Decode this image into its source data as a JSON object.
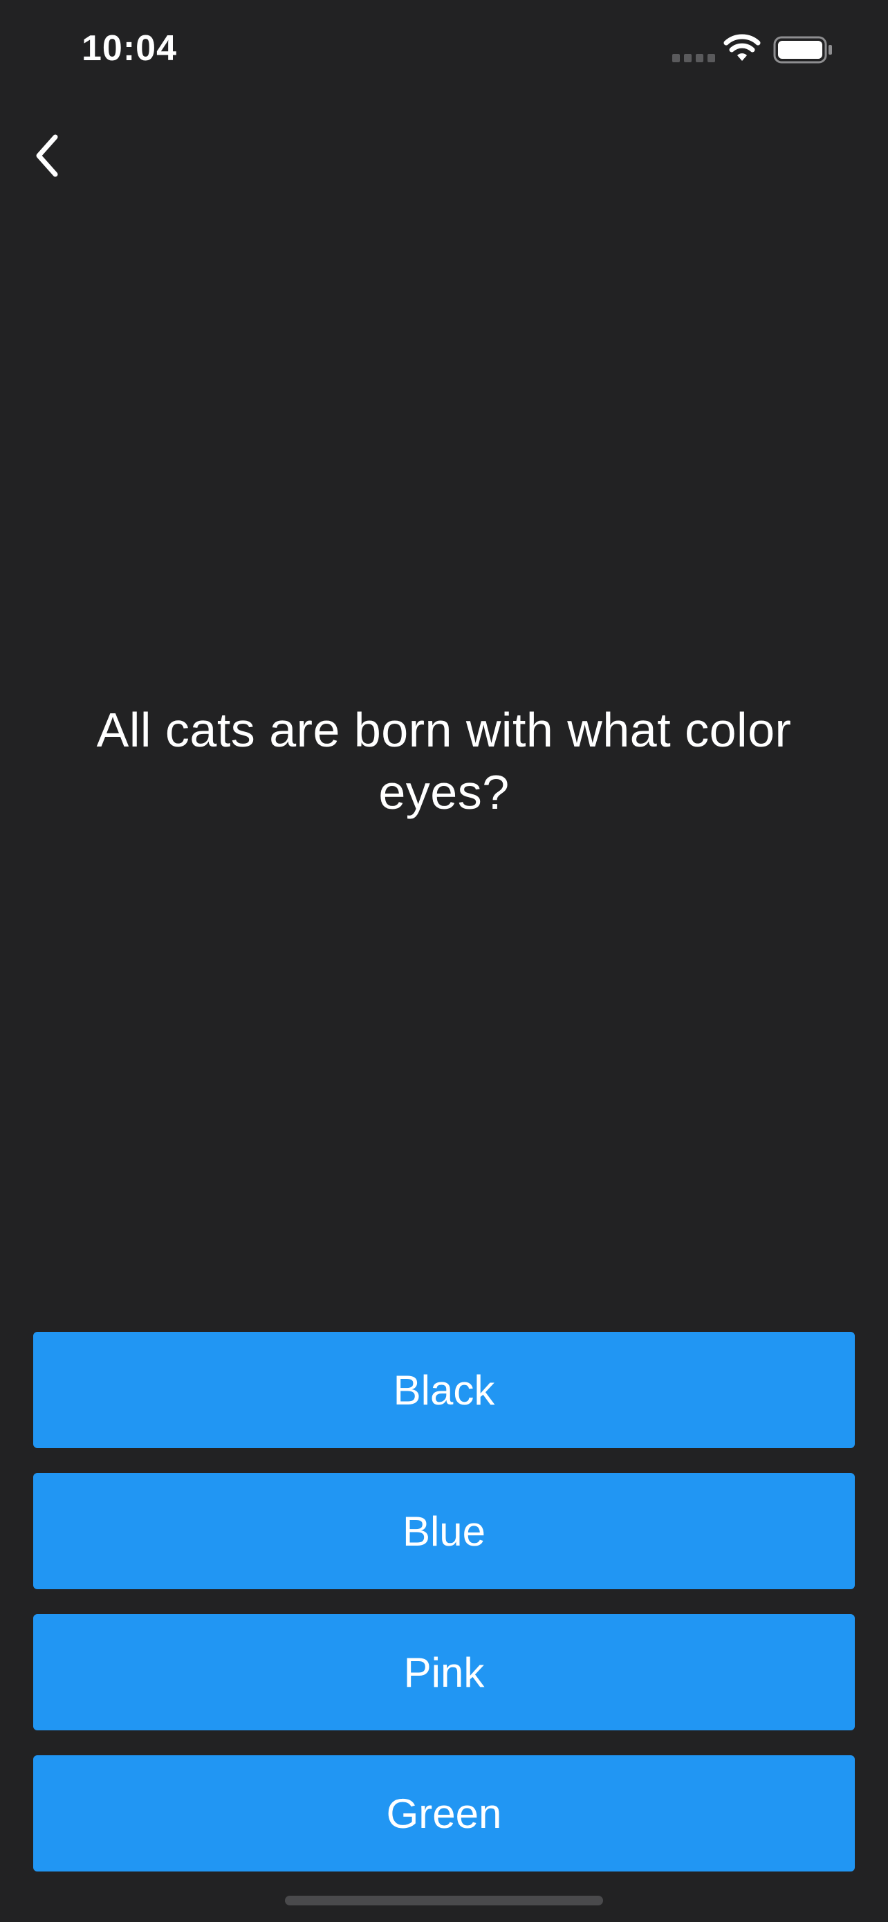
{
  "status_bar": {
    "time": "10:04",
    "icons": [
      "cellular-signal-icon",
      "wifi-icon",
      "battery-icon"
    ]
  },
  "navigation": {
    "back_icon": "chevron-left-icon"
  },
  "question": {
    "text": "All cats are born with what color eyes?"
  },
  "answers": [
    {
      "label": "Black"
    },
    {
      "label": "Blue"
    },
    {
      "label": "Pink"
    },
    {
      "label": "Green"
    }
  ],
  "colors": {
    "background": "#222223",
    "button": "#2196f3",
    "text": "#ffffff"
  }
}
